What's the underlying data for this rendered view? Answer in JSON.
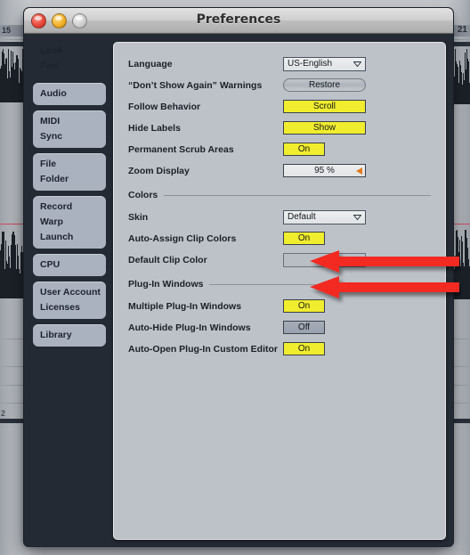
{
  "window": {
    "title": "Preferences",
    "traffic_lights": [
      "close-button",
      "minimize-button",
      "zoom-button"
    ]
  },
  "background": {
    "app": "Ableton Live Arrangement View",
    "markers": [
      "15",
      "21",
      "2"
    ]
  },
  "sidebar": {
    "groups": [
      {
        "items": [
          "Look",
          "Feel"
        ]
      },
      {
        "items": [
          "Audio"
        ]
      },
      {
        "items": [
          "MIDI",
          "Sync"
        ]
      },
      {
        "items": [
          "File",
          "Folder"
        ]
      },
      {
        "items": [
          "Record",
          "Warp",
          "Launch"
        ]
      },
      {
        "items": [
          "CPU"
        ]
      },
      {
        "items": [
          "User Account",
          "Licenses"
        ]
      },
      {
        "items": [
          "Library"
        ]
      }
    ]
  },
  "main": {
    "rows": [
      {
        "label": "Language",
        "control": "dropdown",
        "value": "US-English"
      },
      {
        "label": "“Don’t Show Again” Warnings",
        "control": "pill",
        "value": "Restore"
      },
      {
        "label": "Follow Behavior",
        "control": "toggle-wide-on",
        "value": "Scroll"
      },
      {
        "label": "Hide Labels",
        "control": "toggle-wide-on",
        "value": "Show"
      },
      {
        "label": "Permanent Scrub Areas",
        "control": "toggle-narrow-on",
        "value": "On"
      },
      {
        "label": "Zoom Display",
        "control": "slider",
        "value": "95 %"
      }
    ],
    "colors_section": {
      "title": "Colors",
      "rows": [
        {
          "label": "Skin",
          "control": "dropdown",
          "value": "Default"
        },
        {
          "label": "Auto-Assign Clip Colors",
          "control": "toggle-narrow-on",
          "value": "On"
        },
        {
          "label": "Default Clip Color",
          "control": "dropdown-empty",
          "value": ""
        }
      ]
    },
    "plugin_section": {
      "title": "Plug-In Windows",
      "rows": [
        {
          "label": "Multiple Plug-In Windows",
          "control": "toggle-narrow-on",
          "value": "On"
        },
        {
          "label": "Auto-Hide Plug-In Windows",
          "control": "toggle-narrow-off",
          "value": "Off"
        },
        {
          "label": "Auto-Open Plug-In Custom Editor",
          "control": "toggle-narrow-on",
          "value": "On"
        }
      ]
    }
  },
  "annotations": {
    "arrow_count": 2,
    "arrow_color": "#f22c20",
    "points_to": [
      "Multiple Plug-In Windows",
      "Auto-Hide Plug-In Windows"
    ]
  },
  "colors": {
    "toggle_on": "#f0ec2e",
    "toggle_off": "#9aa3b2",
    "panel_bg": "#bdc2c9",
    "window_frame": "#232a33",
    "sidebar_item": "#aab2c0",
    "slider_accent": "#e07b1e"
  }
}
